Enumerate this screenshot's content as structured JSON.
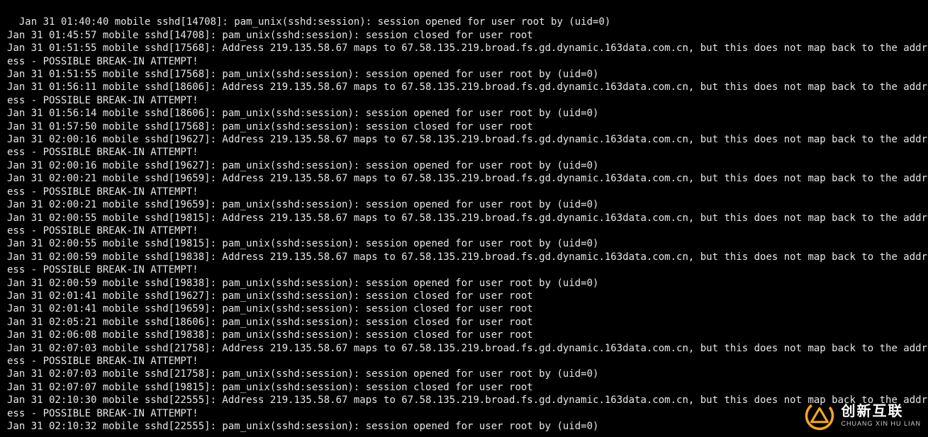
{
  "terminal": {
    "lines": [
      "Jan 31 01:40:40 mobile sshd[14708]: pam_unix(sshd:session): session opened for user root by (uid=0)",
      "Jan 31 01:45:57 mobile sshd[14708]: pam_unix(sshd:session): session closed for user root",
      "Jan 31 01:51:55 mobile sshd[17568]: Address 219.135.58.67 maps to 67.58.135.219.broad.fs.gd.dynamic.163data.com.cn, but this does not map back to the address - POSSIBLE BREAK-IN ATTEMPT!",
      "Jan 31 01:51:55 mobile sshd[17568]: pam_unix(sshd:session): session opened for user root by (uid=0)",
      "Jan 31 01:56:11 mobile sshd[18606]: Address 219.135.58.67 maps to 67.58.135.219.broad.fs.gd.dynamic.163data.com.cn, but this does not map back to the address - POSSIBLE BREAK-IN ATTEMPT!",
      "Jan 31 01:56:14 mobile sshd[18606]: pam_unix(sshd:session): session opened for user root by (uid=0)",
      "Jan 31 01:57:50 mobile sshd[17568]: pam_unix(sshd:session): session closed for user root",
      "Jan 31 02:00:16 mobile sshd[19627]: Address 219.135.58.67 maps to 67.58.135.219.broad.fs.gd.dynamic.163data.com.cn, but this does not map back to the address - POSSIBLE BREAK-IN ATTEMPT!",
      "Jan 31 02:00:16 mobile sshd[19627]: pam_unix(sshd:session): session opened for user root by (uid=0)",
      "Jan 31 02:00:21 mobile sshd[19659]: Address 219.135.58.67 maps to 67.58.135.219.broad.fs.gd.dynamic.163data.com.cn, but this does not map back to the address - POSSIBLE BREAK-IN ATTEMPT!",
      "Jan 31 02:00:21 mobile sshd[19659]: pam_unix(sshd:session): session opened for user root by (uid=0)",
      "Jan 31 02:00:55 mobile sshd[19815]: Address 219.135.58.67 maps to 67.58.135.219.broad.fs.gd.dynamic.163data.com.cn, but this does not map back to the address - POSSIBLE BREAK-IN ATTEMPT!",
      "Jan 31 02:00:55 mobile sshd[19815]: pam_unix(sshd:session): session opened for user root by (uid=0)",
      "Jan 31 02:00:59 mobile sshd[19838]: Address 219.135.58.67 maps to 67.58.135.219.broad.fs.gd.dynamic.163data.com.cn, but this does not map back to the address - POSSIBLE BREAK-IN ATTEMPT!",
      "Jan 31 02:00:59 mobile sshd[19838]: pam_unix(sshd:session): session opened for user root by (uid=0)",
      "Jan 31 02:01:41 mobile sshd[19627]: pam_unix(sshd:session): session closed for user root",
      "Jan 31 02:01:41 mobile sshd[19659]: pam_unix(sshd:session): session closed for user root",
      "Jan 31 02:05:21 mobile sshd[18606]: pam_unix(sshd:session): session closed for user root",
      "Jan 31 02:06:08 mobile sshd[19838]: pam_unix(sshd:session): session closed for user root",
      "Jan 31 02:07:03 mobile sshd[21758]: Address 219.135.58.67 maps to 67.58.135.219.broad.fs.gd.dynamic.163data.com.cn, but this does not map back to the address - POSSIBLE BREAK-IN ATTEMPT!",
      "Jan 31 02:07:03 mobile sshd[21758]: pam_unix(sshd:session): session opened for user root by (uid=0)",
      "Jan 31 02:07:07 mobile sshd[19815]: pam_unix(sshd:session): session closed for user root",
      "Jan 31 02:10:30 mobile sshd[22555]: Address 219.135.58.67 maps to 67.58.135.219.broad.fs.gd.dynamic.163data.com.cn, but this does not map back to the address - POSSIBLE BREAK-IN ATTEMPT!",
      "Jan 31 02:10:32 mobile sshd[22555]: pam_unix(sshd:session): session opened for user root by (uid=0)"
    ]
  },
  "watermark": {
    "main": "创新互联",
    "sub": "CHUANG XIN HU LIAN"
  }
}
